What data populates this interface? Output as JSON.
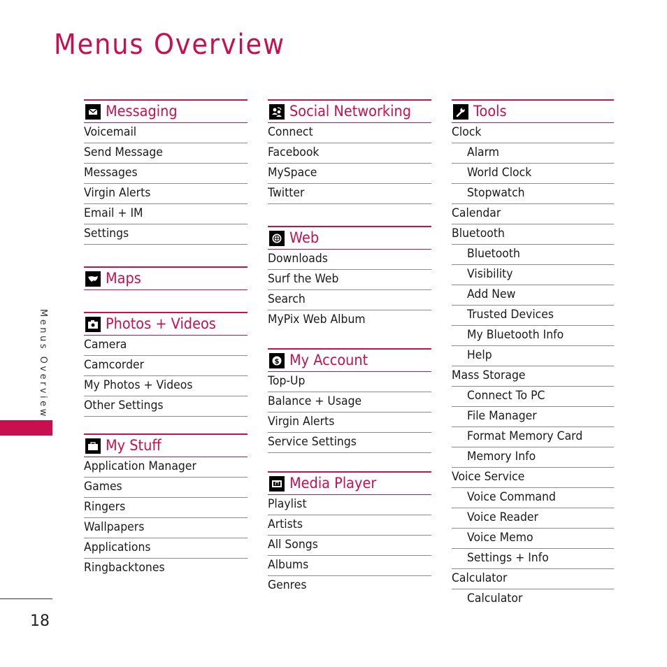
{
  "page": {
    "title": "Menus Overview",
    "side_tab": "Menus Overview",
    "page_number": "18",
    "accent_color": "#c8104e"
  },
  "columns": [
    {
      "sections": [
        {
          "title": "Messaging",
          "icon": "envelope-icon",
          "items": [
            {
              "label": "Voicemail"
            },
            {
              "label": "Send Message"
            },
            {
              "label": "Messages"
            },
            {
              "label": "Virgin Alerts"
            },
            {
              "label": "Email + IM"
            },
            {
              "label": "Settings"
            }
          ]
        },
        {
          "title": "Maps",
          "icon": "map-icon",
          "items": []
        },
        {
          "title": "Photos + Videos",
          "icon": "camera-icon",
          "items": [
            {
              "label": "Camera"
            },
            {
              "label": "Camcorder"
            },
            {
              "label": "My Photos + Videos"
            },
            {
              "label": "Other Settings"
            }
          ]
        },
        {
          "title": "My Stuff",
          "icon": "briefcase-icon",
          "items": [
            {
              "label": "Application Manager"
            },
            {
              "label": "Games"
            },
            {
              "label": "Ringers"
            },
            {
              "label": "Wallpapers"
            },
            {
              "label": "Applications"
            },
            {
              "label": "Ringbacktones"
            }
          ]
        }
      ]
    },
    {
      "sections": [
        {
          "title": "Social Networking",
          "icon": "social-networking-icon",
          "items": [
            {
              "label": "Connect"
            },
            {
              "label": "Facebook"
            },
            {
              "label": "MySpace"
            },
            {
              "label": "Twitter"
            }
          ]
        },
        {
          "title": "Web",
          "icon": "globe-icon",
          "items": [
            {
              "label": "Downloads"
            },
            {
              "label": "Surf the Web"
            },
            {
              "label": "Search"
            },
            {
              "label": "MyPix Web Album"
            }
          ]
        },
        {
          "title": "My Account",
          "icon": "dollar-icon",
          "items": [
            {
              "label": "Top-Up"
            },
            {
              "label": "Balance + Usage"
            },
            {
              "label": "Virgin Alerts"
            },
            {
              "label": "Service Settings"
            }
          ]
        },
        {
          "title": "Media Player",
          "icon": "film-music-icon",
          "items": [
            {
              "label": "Playlist"
            },
            {
              "label": "Artists"
            },
            {
              "label": "All Songs"
            },
            {
              "label": "Albums"
            },
            {
              "label": "Genres"
            }
          ]
        }
      ]
    },
    {
      "sections": [
        {
          "title": "Tools",
          "icon": "wrench-icon",
          "items": [
            {
              "label": "Clock",
              "sub": false
            },
            {
              "label": "Alarm",
              "sub": true
            },
            {
              "label": "World Clock",
              "sub": true
            },
            {
              "label": "Stopwatch",
              "sub": true
            },
            {
              "label": "Calendar",
              "sub": false
            },
            {
              "label": "Bluetooth",
              "sub": false
            },
            {
              "label": "Bluetooth",
              "sub": true
            },
            {
              "label": "Visibility",
              "sub": true
            },
            {
              "label": "Add New",
              "sub": true
            },
            {
              "label": "Trusted Devices",
              "sub": true
            },
            {
              "label": "My Bluetooth Info",
              "sub": true
            },
            {
              "label": "Help",
              "sub": true
            },
            {
              "label": "Mass Storage",
              "sub": false
            },
            {
              "label": "Connect To PC",
              "sub": true
            },
            {
              "label": "File Manager",
              "sub": true
            },
            {
              "label": "Format Memory Card",
              "sub": true
            },
            {
              "label": "Memory Info",
              "sub": true
            },
            {
              "label": "Voice Service",
              "sub": false
            },
            {
              "label": "Voice Command",
              "sub": true
            },
            {
              "label": "Voice Reader",
              "sub": true
            },
            {
              "label": "Voice Memo",
              "sub": true
            },
            {
              "label": "Settings + Info",
              "sub": true
            },
            {
              "label": "Calculator",
              "sub": false
            },
            {
              "label": "Calculator",
              "sub": true
            }
          ]
        }
      ]
    }
  ]
}
